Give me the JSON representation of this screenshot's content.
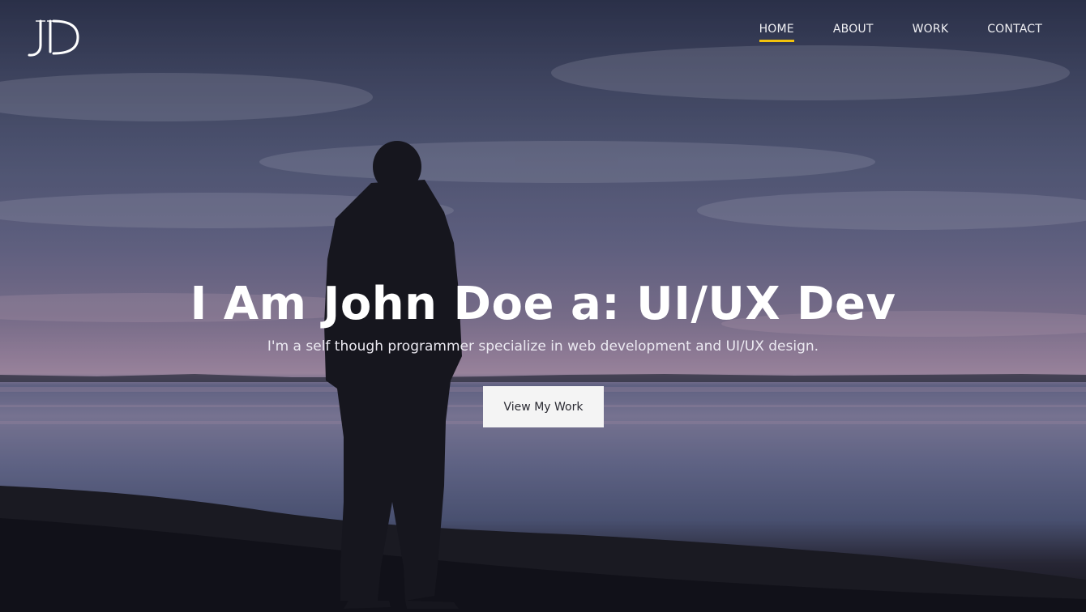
{
  "brand": {
    "logo_icon": "jd-monogram-logo",
    "logo_letters": "JD"
  },
  "nav": {
    "items": [
      {
        "label": "HOME",
        "active": true
      },
      {
        "label": "ABOUT",
        "active": false
      },
      {
        "label": "WORK",
        "active": false
      },
      {
        "label": "CONTACT",
        "active": false
      }
    ],
    "active_indicator_color": "#f2c20c"
  },
  "hero": {
    "title": "I Am John Doe a: UI/UX Dev",
    "subtitle": "I'm a self though programmer specialize in web development and UI/UX design.",
    "cta_label": "View My Work",
    "background_icon": "person-at-lake-dusk-photo"
  }
}
